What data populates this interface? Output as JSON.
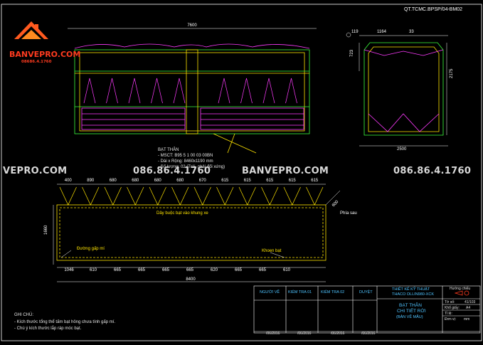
{
  "doc_code": "QT.TCMC.BPSP/04-BM02",
  "logo": {
    "brand": "BANVEPRO.COM",
    "phone": "08686.4.1760"
  },
  "watermark": {
    "site": "VEPRO.COM",
    "site2": "BANVEPRO.COM",
    "phone": "086.86.4.1760",
    "phone2": "086.86.4.1760"
  },
  "top_view": {
    "overall": "7600",
    "label_title": "BẠT THÂN",
    "label_lines": [
      "- MSCT: B95 5 1 00 03 00BN",
      "- Dài x Rộng: 8460x1190 mm",
      "- Số lượng: 02 (Trái, phải đối xứng)"
    ]
  },
  "section_view": {
    "w1": "119",
    "w2": "1164",
    "w3": "33",
    "h1": "723",
    "h2": "2175",
    "w_bottom": "2500"
  },
  "panel": {
    "top_dims": [
      "400",
      "890",
      "680",
      "680",
      "680",
      "680",
      "670",
      "615",
      "615",
      "615",
      "615",
      "615"
    ],
    "side_dim": "1660",
    "corner_dim": "600",
    "bottom_dims": [
      "1046",
      "610",
      "665",
      "665",
      "665",
      "665",
      "620",
      "665",
      "665",
      "610"
    ],
    "overall": "8400",
    "label_rope": "Dây buộc bạt vào khung xe",
    "label_seam": "Đường gấp mí",
    "label_hole": "Khoen bạt",
    "label_rear": "Phía sau"
  },
  "notes": {
    "title": "GHI CHÚ:",
    "lines": [
      "- Kích thước tổng thể tấm bạt hông chưa tính gấp mí.",
      "- Chú ý kích thước lắp ráp móc bạt."
    ]
  },
  "title_block": {
    "drawn": "NGƯỜI VẼ",
    "check1": "KIỂM TRA 01",
    "check2": "KIỂM TRA 02",
    "approve": "DUYỆT",
    "dept_1": "THIẾT KẾ KỸ THUẬT",
    "dept_2": "THACO OLLIN980-XCK",
    "name_1": "BẠT THÂN",
    "name_2": "CHI TIẾT RỜI",
    "name_3": "(BẢN VẼ MẪU)",
    "projection": "Hướng chiếu",
    "sheet": "Tờ số:",
    "sheet_val": "41/103",
    "paper": "Khổ giấy:",
    "paper_val": "A4",
    "scale": "Tỉ lệ:",
    "unit": "Đơn vị:",
    "unit_val": "mm",
    "dates": [
      "/06/2016",
      "/06/2016",
      "/06/2016",
      "/06/2016"
    ]
  }
}
